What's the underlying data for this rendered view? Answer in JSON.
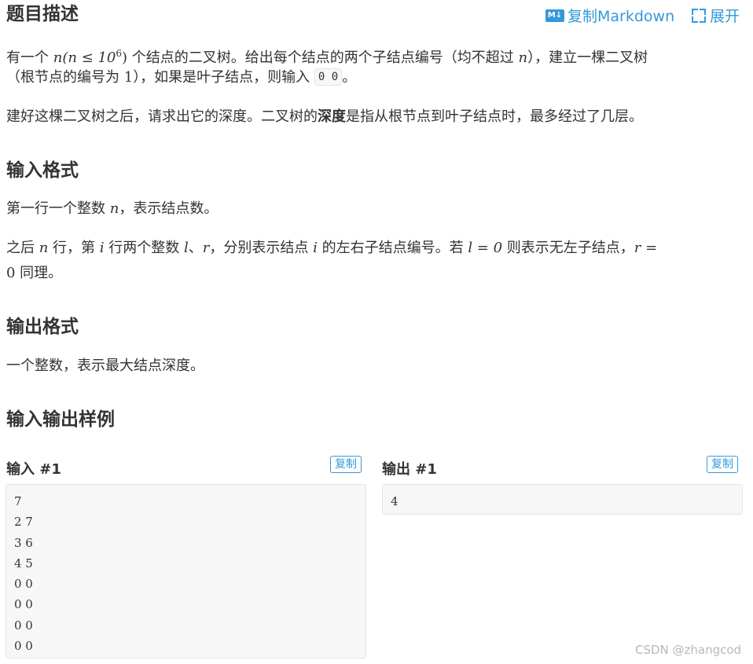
{
  "header": {
    "title": "题目描述",
    "copy_markdown_label": "复制Markdown",
    "copy_markdown_icon": "markdown-icon",
    "expand_label": "展开",
    "expand_icon": "expand-icon"
  },
  "description": {
    "p1_a": "有一个 ",
    "p1_math1": "n(n ≤ 10",
    "p1_math1_sup": "6",
    "p1_math1_close": ")",
    "p1_b": " 个结点的二叉树。给出每个结点的两个子结点编号（均不超过 ",
    "p1_math2": "n",
    "p1_c": "），建立一棵二叉树",
    "p1_d": "（根节点的编号为 ",
    "p1_math3": "1",
    "p1_e": "），如果是叶子结点，则输入 ",
    "p1_code": "0 0",
    "p1_f": "。",
    "p2_a": "建好这棵二叉树之后，请求出它的深度。二叉树的",
    "p2_bold": "深度",
    "p2_b": "是指从根节点到叶子结点时，最多经过了几层。"
  },
  "input_format": {
    "title": "输入格式",
    "p1_a": "第一行一个整数 ",
    "p1_math": "n",
    "p1_b": "，表示结点数。",
    "p2_a": "之后 ",
    "p2_m1": "n",
    "p2_b": " 行，第 ",
    "p2_m2": "i",
    "p2_c": " 行两个整数 ",
    "p2_m3": "l",
    "p2_d": "、",
    "p2_m4": "r",
    "p2_e": "，分别表示结点 ",
    "p2_m5": "i",
    "p2_f": " 的左右子结点编号。若 ",
    "p2_m6": "l = 0",
    "p2_g": " 则表示无左子结点，",
    "p2_m7": "r =",
    "p2_m8": "0",
    "p2_h": " 同理。"
  },
  "output_format": {
    "title": "输出格式",
    "p1": "一个整数，表示最大结点深度。"
  },
  "samples": {
    "title": "输入输出样例",
    "input_title": "输入 #1",
    "output_title": "输出 #1",
    "copy_label": "复制",
    "input_lines": [
      "7",
      "2 7",
      "3 6",
      "4 5",
      "0 0",
      "0 0",
      "0 0",
      "0 0"
    ],
    "output_lines": [
      "4"
    ]
  },
  "watermark": "CSDN @zhangcod",
  "colors": {
    "accent": "#3498db",
    "text": "#333333",
    "code_bg": "#f7f7f7"
  }
}
